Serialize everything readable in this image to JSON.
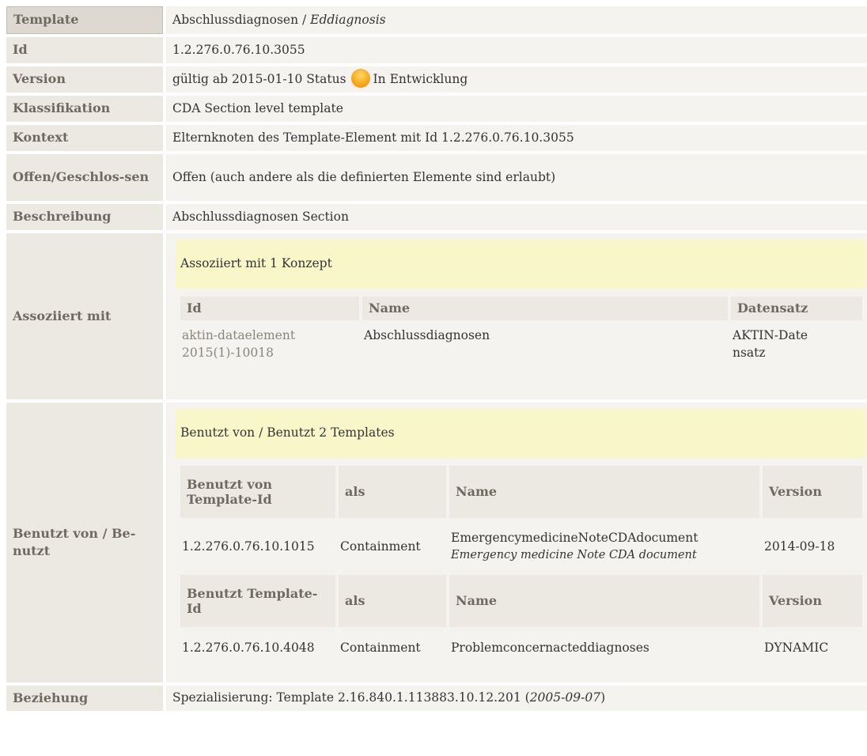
{
  "rows": {
    "template": {
      "label": "Template",
      "name": "Abschlussdiagnosen",
      "sep": " / ",
      "display": "Eddiagnosis"
    },
    "id": {
      "label": "Id",
      "value": "1.2.276.0.76.10.3055"
    },
    "version": {
      "label": "Version",
      "prefix": "gültig ab 2015-01-10 Status",
      "status": "In Entwicklung",
      "status_color": "#f7a91c"
    },
    "klassifikation": {
      "label": "Klassifikation",
      "value": "CDA Section level template"
    },
    "kontext": {
      "label": "Kontext",
      "value": "Elternknoten des Template-Element mit Id 1.2.276.0.76.10.3055"
    },
    "offen": {
      "label": "Offen/Geschlos-sen",
      "value": "Offen (auch andere als die definierten Elemente sind erlaubt)"
    },
    "beschreibung": {
      "label": "Beschreibung",
      "value": "Abschlussdiagnosen Section"
    },
    "assoziiert": {
      "label": "Assoziiert mit",
      "banner": "Assoziiert mit 1 Konzept",
      "headers": {
        "id": "Id",
        "name": "Name",
        "datensatz": "Datensatz"
      },
      "rows": [
        {
          "id": "aktin-dataelement2015(1)-10018",
          "name": "Abschlussdiagnosen",
          "datensatz": "AKTIN-Datensatz"
        }
      ]
    },
    "benutzt": {
      "label": "Benutzt von / Be-nutzt",
      "banner": "Benutzt von / Benutzt 2 Templates",
      "group1": {
        "headers": {
          "tid": "Benutzt von Template-Id",
          "als": "als",
          "name": "Name",
          "version": "Version"
        },
        "row": {
          "tid": "1.2.276.0.76.10.1015",
          "als": "Containment",
          "name": "EmergencymedicineNoteCDAdocument",
          "display": "Emergency medicine Note CDA document",
          "version": "2014-09-18"
        }
      },
      "group2": {
        "headers": {
          "tid": "Benutzt Template-Id",
          "als": "als",
          "name": "Name",
          "version": "Version"
        },
        "row": {
          "tid": "1.2.276.0.76.10.4048",
          "als": "Containment",
          "name": "Problemconcernacteddiagnoses",
          "version": "DYNAMIC"
        }
      }
    },
    "beziehung": {
      "label": "Beziehung",
      "prefix": "Spezialisierung: Template 2.16.840.1.113883.10.12.201 (",
      "date": "2005-09-07",
      "suffix": ")"
    }
  }
}
